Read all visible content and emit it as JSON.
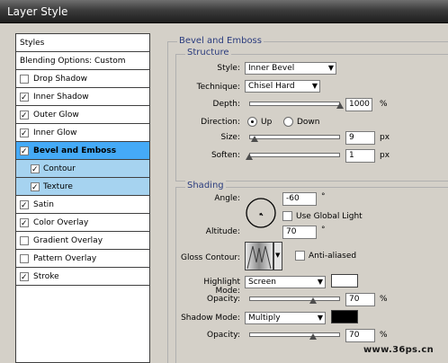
{
  "window": {
    "title": "Layer Style"
  },
  "styles_list": [
    {
      "label": "Styles",
      "checkbox": false
    },
    {
      "label": "Blending Options: Custom",
      "checkbox": false
    },
    {
      "label": "Drop Shadow",
      "checkbox": true,
      "checked": false
    },
    {
      "label": "Inner Shadow",
      "checkbox": true,
      "checked": true
    },
    {
      "label": "Outer Glow",
      "checkbox": true,
      "checked": true
    },
    {
      "label": "Inner Glow",
      "checkbox": true,
      "checked": true
    },
    {
      "label": "Bevel and Emboss",
      "checkbox": true,
      "checked": true,
      "selected": true
    },
    {
      "label": "Contour",
      "checkbox": true,
      "checked": true,
      "sub": true
    },
    {
      "label": "Texture",
      "checkbox": true,
      "checked": true,
      "sub": true
    },
    {
      "label": "Satin",
      "checkbox": true,
      "checked": true
    },
    {
      "label": "Color Overlay",
      "checkbox": true,
      "checked": true
    },
    {
      "label": "Gradient Overlay",
      "checkbox": true,
      "checked": false
    },
    {
      "label": "Pattern Overlay",
      "checkbox": true,
      "checked": false
    },
    {
      "label": "Stroke",
      "checkbox": true,
      "checked": true
    }
  ],
  "bevel": {
    "title": "Bevel and Emboss",
    "structure": {
      "title": "Structure",
      "style_label": "Style:",
      "style_value": "Inner Bevel",
      "technique_label": "Technique:",
      "technique_value": "Chisel Hard",
      "depth_label": "Depth:",
      "depth_value": "1000",
      "depth_unit": "%",
      "depth_level": 1.0,
      "direction_label": "Direction:",
      "direction_up": "Up",
      "direction_down": "Down",
      "direction_selected": "Up",
      "size_label": "Size:",
      "size_value": "9",
      "size_unit": "px",
      "size_level": 0.06,
      "soften_label": "Soften:",
      "soften_value": "1",
      "soften_unit": "px",
      "soften_level": 0.0
    },
    "shading": {
      "title": "Shading",
      "angle_label": "Angle:",
      "angle_value": "-60",
      "angle_unit": "°",
      "use_global_light_label": "Use Global Light",
      "use_global_light_checked": false,
      "altitude_label": "Altitude:",
      "altitude_value": "70",
      "altitude_unit": "°",
      "gloss_contour_label": "Gloss Contour:",
      "anti_aliased_label": "Anti-aliased",
      "anti_aliased_checked": false,
      "highlight_mode_label": "Highlight Mode:",
      "highlight_mode_value": "Screen",
      "highlight_color": "#ffffff",
      "highlight_opacity_label": "Opacity:",
      "highlight_opacity_value": "70",
      "highlight_opacity_unit": "%",
      "highlight_opacity_level": 0.7,
      "shadow_mode_label": "Shadow Mode:",
      "shadow_mode_value": "Multiply",
      "shadow_color": "#000000",
      "shadow_opacity_label": "Opacity:",
      "shadow_opacity_value": "70",
      "shadow_opacity_unit": "%",
      "shadow_opacity_level": 0.7
    }
  },
  "watermark": "www.36ps.cn",
  "colors": {
    "selected_row": "#45aaf7",
    "sub_selected_row": "#a6d3f0",
    "group_title": "#2b3c7e"
  },
  "icons": {
    "dropdown": "chevron-down-icon",
    "checkmark": "check-icon"
  }
}
